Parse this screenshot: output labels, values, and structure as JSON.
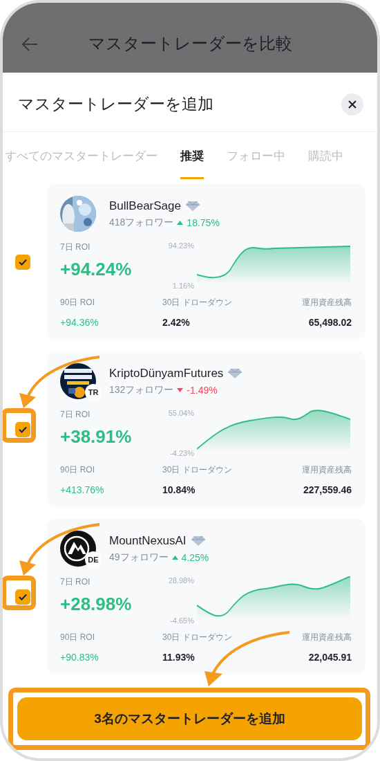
{
  "header": {
    "title": "マスタートレーダーを比較"
  },
  "sheet": {
    "title": "マスタートレーダーを追加"
  },
  "tabs": [
    {
      "label": "すべてのマスタートレーダー",
      "selected": false
    },
    {
      "label": "推奨",
      "selected": true
    },
    {
      "label": "フォロー中",
      "selected": false
    },
    {
      "label": "購読中",
      "selected": false
    }
  ],
  "traders": [
    {
      "name": "BullBearSage",
      "followers": "418フォロワー",
      "kind": "gain",
      "change": "18.75%",
      "roi_7d_label": "7日 ROI",
      "roi_7d": "+94.24%",
      "chart_max": "94.23%",
      "chart_min": "1.16%",
      "roi_90d_label": "90日 ROI",
      "roi_90d": "+94.36%",
      "drawdown_label": "30日 ドローダウン",
      "drawdown": "2.42%",
      "aum_label": "運用資産残高",
      "aum": "65,498.02",
      "checked": true,
      "highlighted": false
    },
    {
      "name": "KriptoDünyamFutures",
      "region": "TR",
      "followers": "132フォロワー",
      "kind": "loss",
      "change": "-1.49%",
      "roi_7d_label": "7日 ROI",
      "roi_7d": "+38.91%",
      "chart_max": "55.04%",
      "chart_min": "-4.23%",
      "roi_90d_label": "90日 ROI",
      "roi_90d": "+413.76%",
      "drawdown_label": "30日 ドローダウン",
      "drawdown": "10.84%",
      "aum_label": "運用資産残高",
      "aum": "227,559.46",
      "checked": true,
      "highlighted": true
    },
    {
      "name": "MountNexusAI",
      "region": "DE",
      "followers": "49フォロワー",
      "kind": "gain",
      "change": "4.25%",
      "roi_7d_label": "7日 ROI",
      "roi_7d": "+28.98%",
      "chart_max": "28.98%",
      "chart_min": "-4.65%",
      "roi_90d_label": "90日 ROI",
      "roi_90d": "+90.83%",
      "drawdown_label": "30日 ドローダウン",
      "drawdown": "11.93%",
      "aum_label": "運用資産残高",
      "aum": "22,045.91",
      "checked": true,
      "highlighted": true
    }
  ],
  "add_button": {
    "label": "3名のマスタートレーダーを追加",
    "highlighted": true
  }
}
